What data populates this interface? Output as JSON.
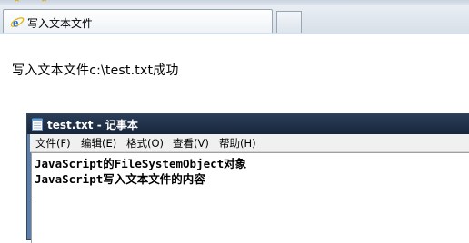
{
  "browser": {
    "tab_title": "写入文本文件"
  },
  "page": {
    "message": "写入文本文件c:\\test.txt成功"
  },
  "notepad": {
    "title": "test.txt - 记事本",
    "menu": [
      {
        "label": "文件(F)"
      },
      {
        "label": "编辑(E)"
      },
      {
        "label": "格式(O)"
      },
      {
        "label": "查看(V)"
      },
      {
        "label": "帮助(H)"
      }
    ],
    "lines": [
      "JavaScript的FileSystemObject对象",
      "JavaScript写入文本文件的内容"
    ]
  }
}
